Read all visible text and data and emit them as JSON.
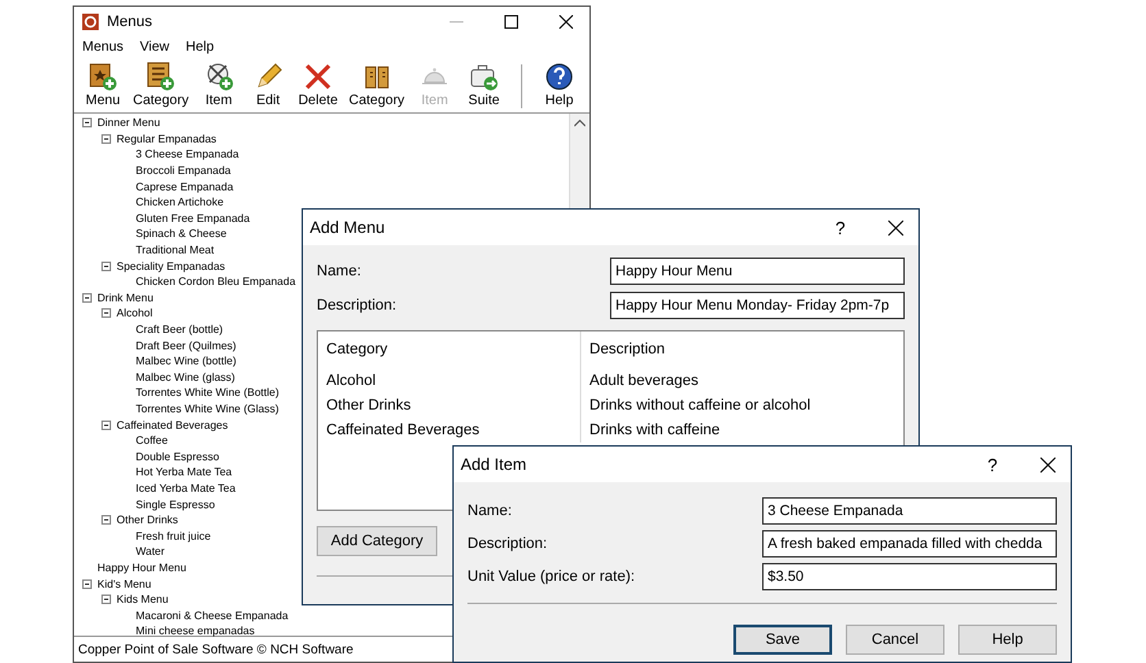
{
  "main_window": {
    "title": "Menus",
    "menu_bar": [
      "Menus",
      "View",
      "Help"
    ],
    "toolbar": [
      {
        "label": "Menu",
        "disabled": false
      },
      {
        "label": "Category",
        "disabled": false
      },
      {
        "label": "Item",
        "disabled": false
      },
      {
        "label": "Edit",
        "disabled": false
      },
      {
        "label": "Delete",
        "disabled": false
      },
      {
        "label": "Category",
        "disabled": false
      },
      {
        "label": "Item",
        "disabled": true
      },
      {
        "label": "Suite",
        "disabled": false
      },
      {
        "label": "Help",
        "disabled": false
      }
    ],
    "tree": [
      {
        "label": "Dinner Menu",
        "expanded": true,
        "children": [
          {
            "label": "Regular Empanadas",
            "expanded": true,
            "children": [
              {
                "label": "3 Cheese Empanada"
              },
              {
                "label": "Broccoli Empanada"
              },
              {
                "label": "Caprese Empanada"
              },
              {
                "label": "Chicken Artichoke"
              },
              {
                "label": "Gluten Free Empanada"
              },
              {
                "label": "Spinach & Cheese"
              },
              {
                "label": "Traditional Meat"
              }
            ]
          },
          {
            "label": "Speciality Empanadas",
            "expanded": true,
            "children": [
              {
                "label": "Chicken Cordon Bleu Empanada"
              }
            ]
          }
        ]
      },
      {
        "label": "Drink Menu",
        "expanded": true,
        "children": [
          {
            "label": "Alcohol",
            "expanded": true,
            "children": [
              {
                "label": "Craft Beer (bottle)"
              },
              {
                "label": "Draft Beer (Quilmes)"
              },
              {
                "label": "Malbec Wine (bottle)"
              },
              {
                "label": "Malbec Wine (glass)"
              },
              {
                "label": "Torrentes White Wine (Bottle)"
              },
              {
                "label": "Torrentes White Wine (Glass)"
              }
            ]
          },
          {
            "label": "Caffeinated Beverages",
            "expanded": true,
            "children": [
              {
                "label": "Coffee"
              },
              {
                "label": "Double Espresso"
              },
              {
                "label": "Hot Yerba Mate Tea"
              },
              {
                "label": "Iced Yerba Mate Tea"
              },
              {
                "label": "Single Espresso"
              }
            ]
          },
          {
            "label": "Other Drinks",
            "expanded": true,
            "children": [
              {
                "label": "Fresh fruit juice"
              },
              {
                "label": "Water"
              }
            ]
          }
        ]
      },
      {
        "label": "Happy Hour Menu"
      },
      {
        "label": "Kid's Menu",
        "expanded": true,
        "children": [
          {
            "label": "Kids Menu",
            "expanded": true,
            "children": [
              {
                "label": "Macaroni & Cheese Empanada"
              },
              {
                "label": "Mini cheese empanadas"
              }
            ]
          }
        ]
      }
    ],
    "status_bar": "Copper Point of Sale Software © NCH Software"
  },
  "add_menu_dialog": {
    "title": "Add Menu",
    "help_glyph": "?",
    "name_label": "Name:",
    "name_value": "Happy Hour Menu",
    "description_label": "Description:",
    "description_value": "Happy Hour Menu Monday- Friday 2pm-7p",
    "table": {
      "columns": [
        "Category",
        "Description"
      ],
      "rows": [
        [
          "Alcohol",
          "Adult beverages"
        ],
        [
          "Other Drinks",
          "Drinks without caffeine or alcohol"
        ],
        [
          "Caffeinated Beverages",
          "Drinks with caffeine"
        ]
      ]
    },
    "add_category_button": "Add Category"
  },
  "add_item_dialog": {
    "title": "Add Item",
    "help_glyph": "?",
    "fields": [
      {
        "label": "Name:",
        "value": "3 Cheese Empanada"
      },
      {
        "label": "Description:",
        "value": "A fresh baked empanada filled with chedda"
      },
      {
        "label": "Unit Value (price or rate):",
        "value": "$3.50"
      }
    ],
    "buttons": [
      {
        "label": "Save",
        "focused": true
      },
      {
        "label": "Cancel",
        "focused": false
      },
      {
        "label": "Help",
        "focused": false
      }
    ]
  }
}
